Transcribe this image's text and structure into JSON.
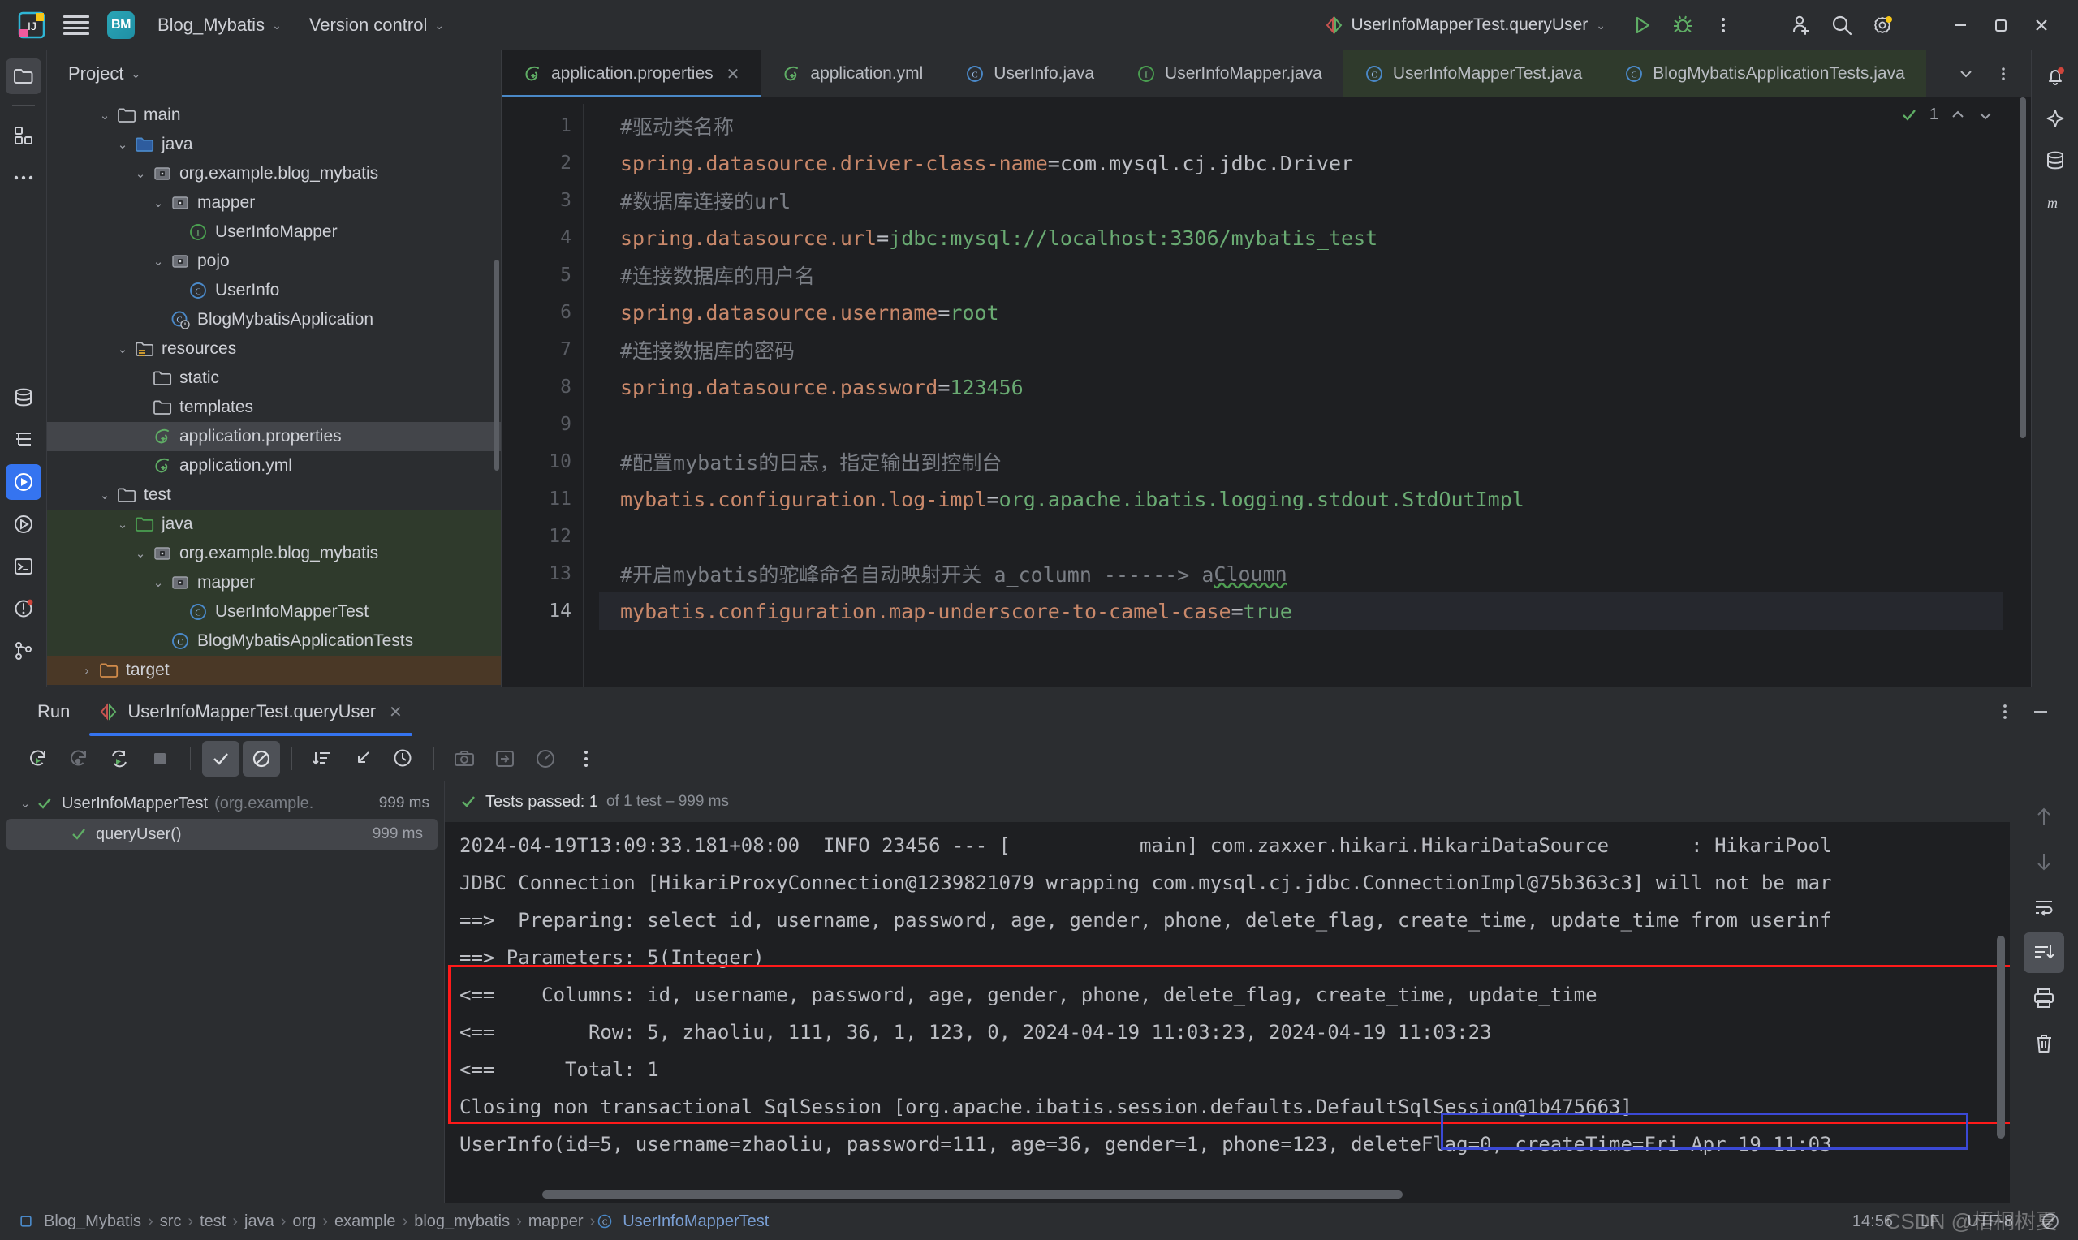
{
  "titlebar": {
    "project_name": "Blog_Mybatis",
    "project_initials": "BM",
    "version_control": "Version control",
    "run_config": "UserInfoMapperTest.queryUser"
  },
  "left_rail": [
    {
      "name": "project-tool-window",
      "icon": "folder-icon",
      "active": true
    },
    {
      "name": "structure-tool-window",
      "icon": "blocks-icon",
      "active": false
    },
    {
      "name": "more-tool-windows",
      "icon": "more-dots-icon",
      "active": false
    }
  ],
  "left_rail_bottom": [
    {
      "name": "database-tool-window",
      "icon": "database-icon"
    },
    {
      "name": "structure-tool-window-2",
      "icon": "structure-icon"
    },
    {
      "name": "run-tool-window",
      "icon": "run-icon",
      "active": true
    },
    {
      "name": "debug-tool-window",
      "icon": "debug-icon"
    },
    {
      "name": "terminal-tool-window",
      "icon": "terminal-icon"
    },
    {
      "name": "problems-tool-window",
      "icon": "problems-icon"
    },
    {
      "name": "git-tool-window",
      "icon": "git-icon"
    }
  ],
  "right_rail": [
    {
      "name": "notifications",
      "icon": "bell-icon"
    },
    {
      "name": "ai-assistant",
      "icon": "ai-icon"
    },
    {
      "name": "database",
      "icon": "database-icon"
    },
    {
      "name": "maven",
      "icon": "maven-m-icon"
    }
  ],
  "project": {
    "header": "Project",
    "tree": [
      {
        "label": "main",
        "indent": 2,
        "arrow": "down",
        "icon": "folder",
        "scope": "none"
      },
      {
        "label": "java",
        "indent": 3,
        "arrow": "down",
        "icon": "folder-source",
        "scope": "none"
      },
      {
        "label": "org.example.blog_mybatis",
        "indent": 4,
        "arrow": "down",
        "icon": "package",
        "scope": "none"
      },
      {
        "label": "mapper",
        "indent": 5,
        "arrow": "down",
        "icon": "package",
        "scope": "none"
      },
      {
        "label": "UserInfoMapper",
        "indent": 6,
        "arrow": "none",
        "icon": "interface",
        "scope": "none"
      },
      {
        "label": "pojo",
        "indent": 5,
        "arrow": "down",
        "icon": "package",
        "scope": "none"
      },
      {
        "label": "UserInfo",
        "indent": 6,
        "arrow": "none",
        "icon": "class",
        "scope": "none"
      },
      {
        "label": "BlogMybatisApplication",
        "indent": 5,
        "arrow": "none",
        "icon": "class-run",
        "scope": "none"
      },
      {
        "label": "resources",
        "indent": 3,
        "arrow": "down",
        "icon": "folder-res",
        "scope": "none"
      },
      {
        "label": "static",
        "indent": 4,
        "arrow": "none",
        "icon": "folder",
        "scope": "none"
      },
      {
        "label": "templates",
        "indent": 4,
        "arrow": "none",
        "icon": "folder",
        "scope": "none"
      },
      {
        "label": "application.properties",
        "indent": 4,
        "arrow": "none",
        "icon": "spring",
        "scope": "selected"
      },
      {
        "label": "application.yml",
        "indent": 4,
        "arrow": "none",
        "icon": "spring",
        "scope": "none"
      },
      {
        "label": "test",
        "indent": 2,
        "arrow": "down",
        "icon": "folder",
        "scope": "none"
      },
      {
        "label": "java",
        "indent": 3,
        "arrow": "down",
        "icon": "folder-test",
        "scope": "test"
      },
      {
        "label": "org.example.blog_mybatis",
        "indent": 4,
        "arrow": "down",
        "icon": "package",
        "scope": "test"
      },
      {
        "label": "mapper",
        "indent": 5,
        "arrow": "down",
        "icon": "package",
        "scope": "test"
      },
      {
        "label": "UserInfoMapperTest",
        "indent": 6,
        "arrow": "none",
        "icon": "class",
        "scope": "test"
      },
      {
        "label": "BlogMybatisApplicationTests",
        "indent": 5,
        "arrow": "none",
        "icon": "class",
        "scope": "test"
      },
      {
        "label": "target",
        "indent": 1,
        "arrow": "right",
        "icon": "folder-target",
        "scope": "target"
      }
    ]
  },
  "editor": {
    "tabs": [
      {
        "label": "application.properties",
        "icon": "spring-icon",
        "active": true,
        "closable": true,
        "green": false
      },
      {
        "label": "application.yml",
        "icon": "spring-icon",
        "active": false,
        "closable": false,
        "green": false
      },
      {
        "label": "UserInfo.java",
        "icon": "class-icon",
        "active": false,
        "closable": false,
        "green": false
      },
      {
        "label": "UserInfoMapper.java",
        "icon": "interface-icon",
        "active": false,
        "closable": false,
        "green": false
      },
      {
        "label": "UserInfoMapperTest.java",
        "icon": "class-icon",
        "active": false,
        "closable": false,
        "green": true
      },
      {
        "label": "BlogMybatisApplicationTests.java",
        "icon": "class-icon",
        "active": false,
        "closable": false,
        "green": true
      }
    ],
    "inspection_count": "1",
    "lines": [
      {
        "n": "1",
        "type": "comment",
        "text": "#驱动类名称"
      },
      {
        "n": "2",
        "type": "prop",
        "key": "spring.datasource.driver-class-name",
        "eq": "=",
        "val": "com.mysql.cj.jdbc.Driver",
        "valclass": "plain",
        "gutter_icon": "datasource-icon"
      },
      {
        "n": "3",
        "type": "comment",
        "text": "#数据库连接的url"
      },
      {
        "n": "4",
        "type": "prop",
        "key": "spring.datasource.url",
        "eq": "=",
        "val": "jdbc:mysql://localhost:3306/mybatis_test",
        "valclass": "val"
      },
      {
        "n": "5",
        "type": "comment",
        "text": "#连接数据库的用户名"
      },
      {
        "n": "6",
        "type": "prop",
        "key": "spring.datasource.username",
        "eq": "=",
        "val": "root",
        "valclass": "val"
      },
      {
        "n": "7",
        "type": "comment",
        "text": "#连接数据库的密码"
      },
      {
        "n": "8",
        "type": "prop",
        "key": "spring.datasource.password",
        "eq": "=",
        "val": "123456",
        "valclass": "val"
      },
      {
        "n": "9",
        "type": "blank",
        "text": ""
      },
      {
        "n": "10",
        "type": "comment",
        "text": "#配置mybatis的日志，指定输出到控制台"
      },
      {
        "n": "11",
        "type": "prop",
        "key": "mybatis.configuration.log-impl",
        "eq": "=",
        "val": "org.apache.ibatis.logging.stdout.StdOutImpl",
        "valclass": "val"
      },
      {
        "n": "12",
        "type": "blank",
        "text": ""
      },
      {
        "n": "13",
        "type": "comment-squig",
        "text": "#开启mybatis的驼峰命名自动映射开关 a_column ------> a",
        "squig": "Cloumn"
      },
      {
        "n": "14",
        "type": "prop",
        "key": "mybatis.configuration.map-underscore-to-camel-case",
        "eq": "=",
        "val": "true",
        "valclass": "val",
        "current": true
      }
    ]
  },
  "run_panel": {
    "title": "Run",
    "tab_label": "UserInfoMapperTest.queryUser",
    "toolbar": [
      {
        "name": "rerun-button",
        "icon": "rerun-icon",
        "on": false
      },
      {
        "name": "rerun-failed-button",
        "icon": "rerun-failed-icon",
        "on": false
      },
      {
        "name": "toggle-auto-test-button",
        "icon": "auto-test-icon",
        "on": false
      },
      {
        "name": "stop-button",
        "icon": "stop-icon",
        "on": false
      },
      {
        "name": "show-passed-button",
        "icon": "check-icon",
        "on": true
      },
      {
        "name": "show-ignored-button",
        "icon": "ignored-icon",
        "on": true
      },
      {
        "name": "sort-by-duration-button",
        "icon": "sort-icon",
        "on": false
      },
      {
        "name": "expand-collapse-button",
        "icon": "collapse-icon",
        "on": false
      },
      {
        "name": "history-button",
        "icon": "clock-icon",
        "on": false
      },
      {
        "name": "export-image-button",
        "icon": "camera-icon",
        "on": false
      },
      {
        "name": "import-tests-button",
        "icon": "import-icon",
        "on": false
      },
      {
        "name": "profile-button",
        "icon": "gauge-icon",
        "on": false
      },
      {
        "name": "more-options-button",
        "icon": "more-vertical-icon",
        "on": false
      }
    ],
    "test_tree": [
      {
        "label": "UserInfoMapperTest",
        "suffix": "(org.example.",
        "duration": "999 ms",
        "indent": 0,
        "arrow": "down",
        "selected": false
      },
      {
        "label": "queryUser()",
        "suffix": "",
        "duration": "999 ms",
        "indent": 1,
        "arrow": "none",
        "selected": true
      }
    ],
    "status": {
      "main": "Tests passed: 1",
      "detail": "of 1 test – 999 ms"
    },
    "console": [
      "2024-04-19T13:09:33.181+08:00  INFO 23456 --- [           main] com.zaxxer.hikari.HikariDataSource       : HikariPool",
      "JDBC Connection [HikariProxyConnection@1239821079 wrapping com.mysql.cj.jdbc.ConnectionImpl@75b363c3] will not be mar",
      "==>  Preparing: select id, username, password, age, gender, phone, delete_flag, create_time, update_time from userinf",
      "==> Parameters: 5(Integer)",
      "<==    Columns: id, username, password, age, gender, phone, delete_flag, create_time, update_time",
      "<==        Row: 5, zhaoliu, 111, 36, 1, 123, 0, 2024-04-19 11:03:23, 2024-04-19 11:03:23",
      "<==      Total: 1",
      "Closing non transactional SqlSession [org.apache.ibatis.session.defaults.DefaultSqlSession@1b475663]",
      "UserInfo(id=5, username=zhaoliu, password=111, age=36, gender=1, phone=123, deleteFlag=0, createTime=Fri Apr 19 11:03"
    ],
    "console_rail": [
      {
        "name": "scroll-up-button",
        "icon": "arrow-up-icon",
        "on": false
      },
      {
        "name": "scroll-down-button",
        "icon": "arrow-down-icon",
        "on": false
      },
      {
        "name": "soft-wrap-button",
        "icon": "wrap-icon",
        "on": false
      },
      {
        "name": "scroll-to-end-button",
        "icon": "scroll-end-icon",
        "on": true
      },
      {
        "name": "print-button",
        "icon": "printer-icon",
        "on": false
      },
      {
        "name": "clear-all-button",
        "icon": "trash-icon",
        "on": false
      }
    ]
  },
  "status_bar": {
    "breadcrumbs": [
      {
        "label": "Blog_Mybatis",
        "icon": "module-icon"
      },
      {
        "label": "src",
        "icon": "none"
      },
      {
        "label": "test",
        "icon": "none"
      },
      {
        "label": "java",
        "icon": "none"
      },
      {
        "label": "org",
        "icon": "none"
      },
      {
        "label": "example",
        "icon": "none"
      },
      {
        "label": "blog_mybatis",
        "icon": "none"
      },
      {
        "label": "mapper",
        "icon": "none"
      },
      {
        "label": "UserInfoMapperTest",
        "icon": "class-icon"
      }
    ],
    "time": "14:56",
    "line_sep": "LF",
    "encoding": "UTF-8",
    "watermark": "CSDN @梧桐树夏"
  },
  "colors": {
    "accent_blue": "#3574f0",
    "green": "#5fad65",
    "red_box": "#ff1a1a",
    "blue_box": "#3b49d6",
    "bg": "#2b2d30",
    "editor_bg": "#1e1f22"
  }
}
